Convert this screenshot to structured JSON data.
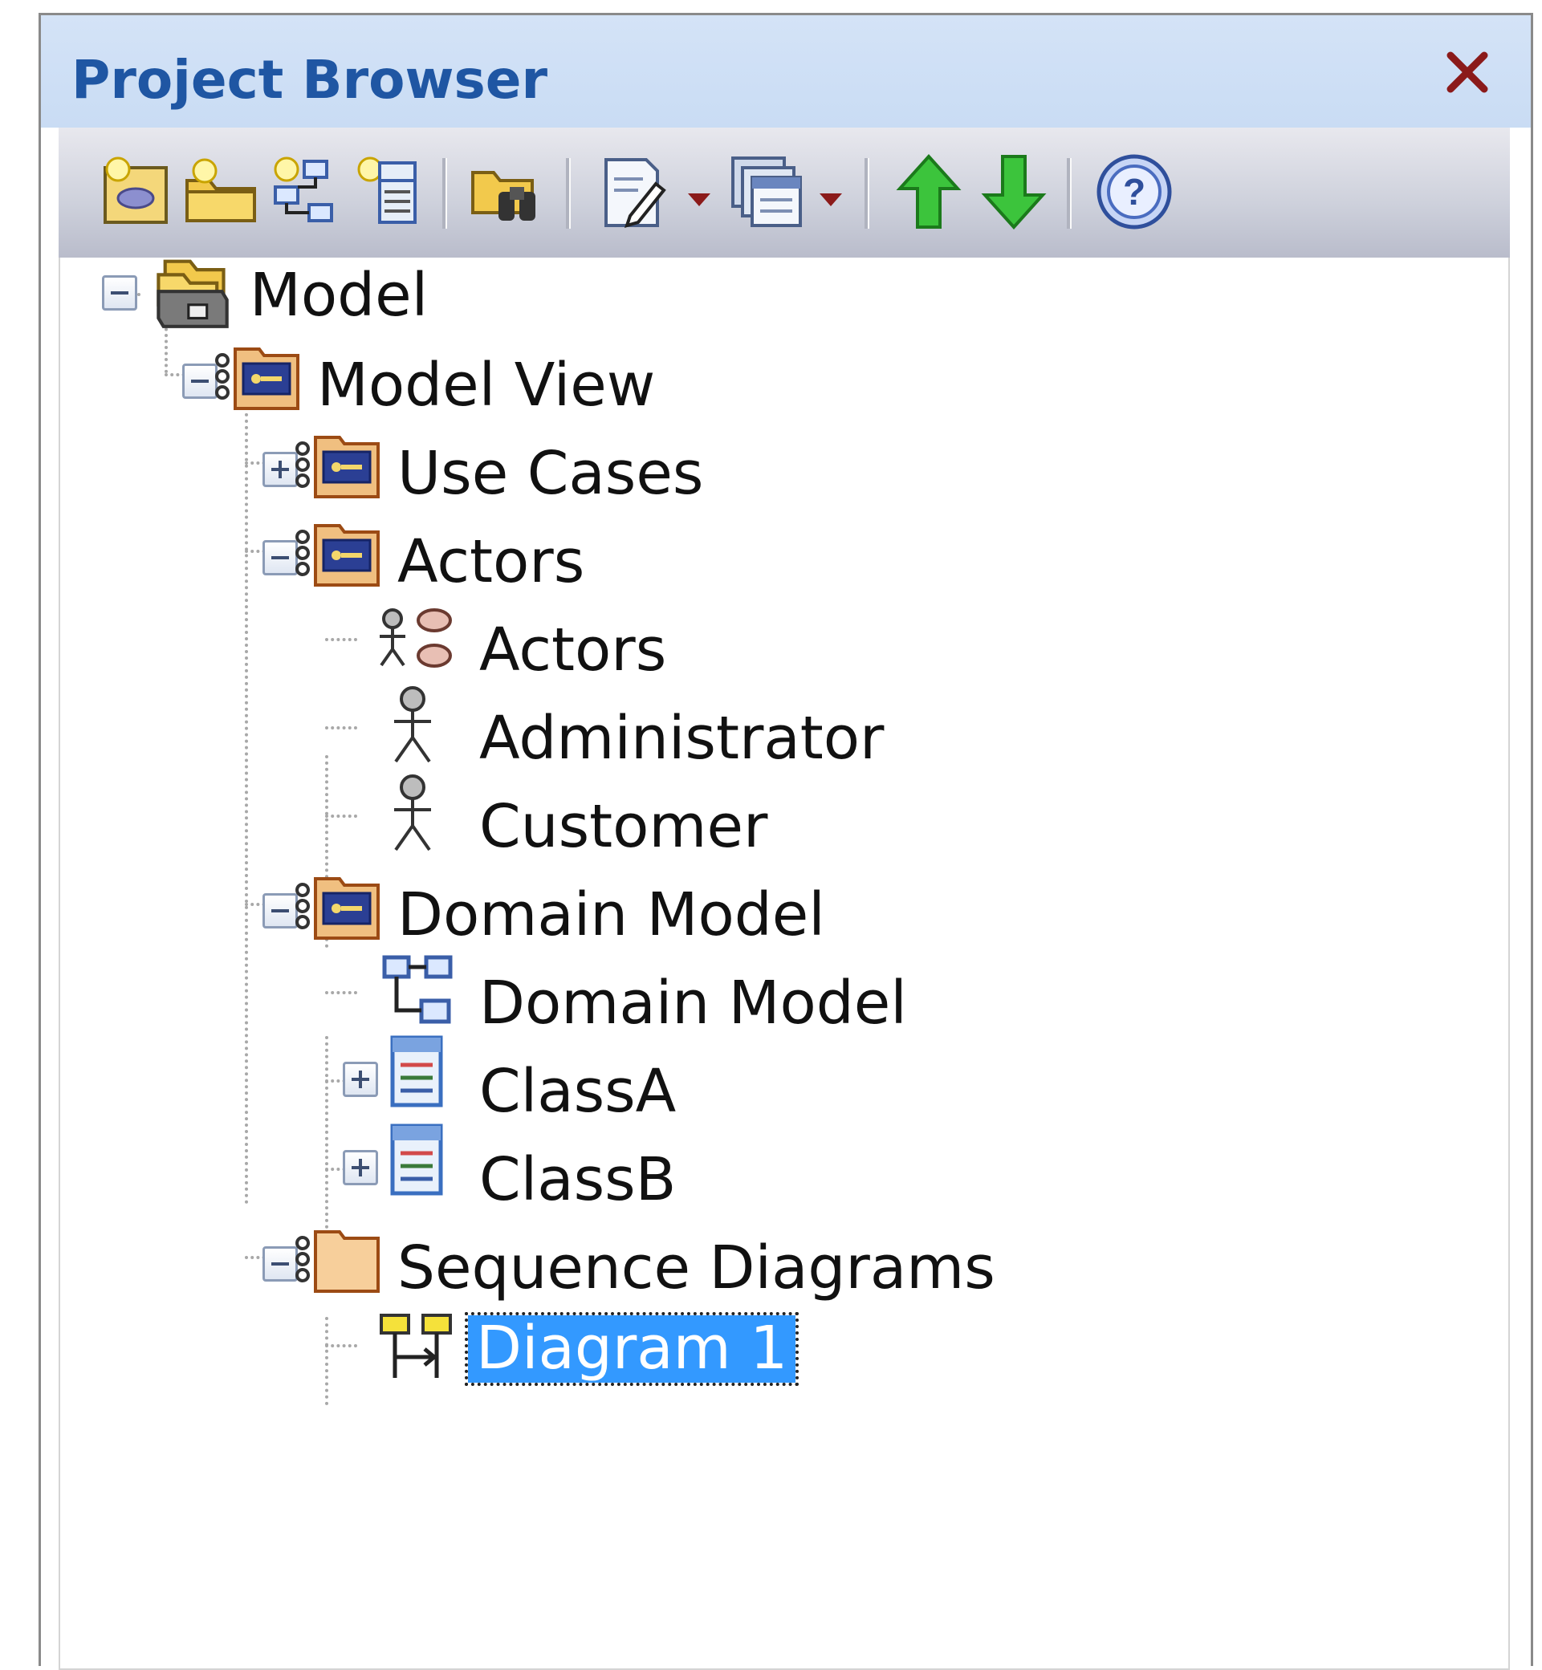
{
  "window": {
    "title": "Project Browser"
  },
  "toolbar": {
    "buttons": [
      {
        "icon": "new-model-package-icon"
      },
      {
        "icon": "new-package-icon"
      },
      {
        "icon": "new-diagram-icon"
      },
      {
        "icon": "new-element-icon"
      },
      {
        "icon": "find-in-project-icon"
      },
      {
        "icon": "documentation-icon",
        "has_dropdown": true
      },
      {
        "icon": "generate-report-icon",
        "has_dropdown": true
      },
      {
        "icon": "move-up-icon"
      },
      {
        "icon": "move-down-icon"
      },
      {
        "icon": "help-icon"
      }
    ]
  },
  "tree": {
    "nodes": [
      {
        "label": "Model",
        "icon": "model-root-icon",
        "expander": "collapse"
      },
      {
        "label": "Model View",
        "icon": "view-package-icon",
        "expander": "collapse"
      },
      {
        "label": "Use Cases",
        "icon": "view-package-icon",
        "expander": "expand"
      },
      {
        "label": "Actors",
        "icon": "view-package-icon",
        "expander": "collapse"
      },
      {
        "label": "Actors",
        "icon": "use-case-diagram-icon",
        "expander": "none"
      },
      {
        "label": "Administrator",
        "icon": "actor-icon",
        "expander": "none"
      },
      {
        "label": "Customer",
        "icon": "actor-icon",
        "expander": "none"
      },
      {
        "label": "Domain Model",
        "icon": "view-package-icon",
        "expander": "collapse"
      },
      {
        "label": "Domain Model",
        "icon": "class-diagram-icon",
        "expander": "none"
      },
      {
        "label": "ClassA",
        "icon": "class-icon",
        "expander": "expand"
      },
      {
        "label": "ClassB",
        "icon": "class-icon",
        "expander": "expand"
      },
      {
        "label": "Sequence Diagrams",
        "icon": "view-package-plain-icon",
        "expander": "collapse"
      },
      {
        "label": "Diagram 1",
        "icon": "sequence-diagram-icon",
        "expander": "none",
        "selected": true
      }
    ]
  },
  "colors": {
    "title_text": "#1f56a3",
    "title_bar": "#c9dcf4",
    "selection": "#3399ff",
    "close_icon": "#8b1a1a",
    "arrow_green": "#2fb82f"
  }
}
